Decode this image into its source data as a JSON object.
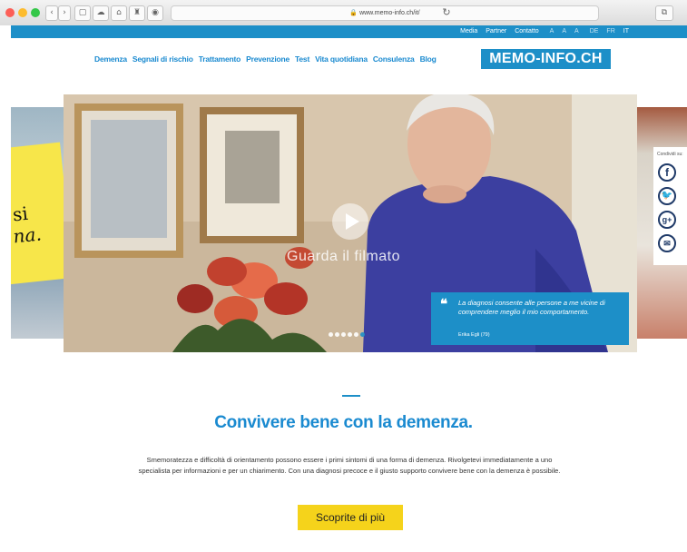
{
  "browser": {
    "url": "www.memo-info.ch/it/",
    "traffic_lights": [
      "#fc5f57",
      "#fdbc2e",
      "#33c748"
    ],
    "back_icon": "chevron-left-icon",
    "forward_icon": "chevron-right-icon"
  },
  "topbar": {
    "links": [
      "Media",
      "Partner",
      "Contatto"
    ],
    "font_sizes": [
      "A",
      "A",
      "A"
    ],
    "languages": [
      "DE",
      "FR",
      "IT"
    ],
    "color": "#1d8fc8"
  },
  "nav": {
    "items": [
      "Demenza",
      "Segnali di rischio",
      "Trattamento",
      "Prevenzione",
      "Test",
      "Vita quotidiana",
      "Consulenza",
      "Blog"
    ],
    "logo": "MEMO-INFO.CH"
  },
  "hero": {
    "watch_label": "Guarda il filmato",
    "quote": "La diagnosi consente alle persone a me vicine di comprendere meglio il mio comportamento.",
    "author": "Erika Egli (79)",
    "slide_count": 6,
    "active_slide": 6,
    "left_fragment": [
      "si",
      "na."
    ]
  },
  "share": {
    "label": "Condividi su:",
    "icons": [
      "facebook-icon",
      "twitter-icon",
      "google-plus-icon",
      "email-icon"
    ]
  },
  "main": {
    "title": "Convivere bene con la demenza.",
    "description": "Smemoratezza e difficoltà di orientamento possono essere i primi sintomi di una forma di demenza. Rivolgetevi immediatamente a uno specialista per informazioni e per un chiarimento. Con una diagnosi precoce e il giusto supporto convivere bene con la demenza è possibile.",
    "cta": "Scoprite di più",
    "accent": "#1a8ad0",
    "cta_color": "#f5d31b"
  }
}
